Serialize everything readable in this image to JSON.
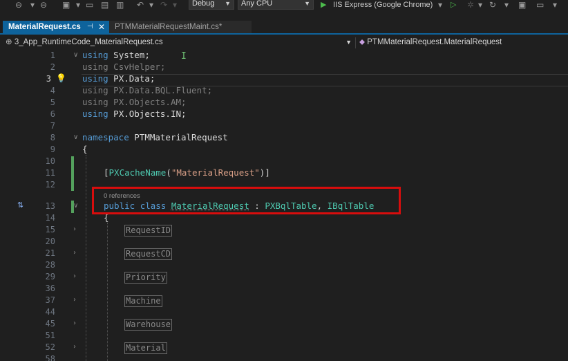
{
  "toolbar": {
    "config_select": "Debug",
    "platform_select": "Any CPU",
    "run_target": "IIS Express (Google Chrome)"
  },
  "tabs": [
    {
      "label": "MaterialRequest.cs",
      "active": true
    },
    {
      "label": "PTMMaterialRequestMaint.cs*",
      "active": false
    }
  ],
  "navbar": {
    "project": "3_App_RuntimeCode_MaterialRequest.cs",
    "member": "PTMMaterialRequest.MaterialRequest"
  },
  "editor": {
    "line_numbers": [
      "1",
      "2",
      "3",
      "4",
      "5",
      "6",
      "7",
      "8",
      "9",
      "10",
      "11",
      "12",
      "13",
      "14",
      "15",
      "20",
      "21",
      "28",
      "29",
      "36",
      "37",
      "44",
      "45",
      "51",
      "52",
      "58"
    ],
    "current_line": "3",
    "code": {
      "using": "using",
      "ns_system": "System;",
      "ns_csvhelper": "CsvHelper;",
      "ns_pxdata": "PX.Data;",
      "ns_pxdata_bql": "PX.Data.BQL.Fluent;",
      "ns_pxobjects_am": "PX.Objects.AM;",
      "ns_pxobjects_in": "PX.Objects.IN;",
      "namespace_kw": "namespace",
      "namespace_name": "PTMMaterialRequest",
      "open_brace": "{",
      "attr_open": "[",
      "attr_name": "PXCacheName",
      "attr_paren_open": "(",
      "attr_value": "\"MaterialRequest\"",
      "attr_close": ")]",
      "references": "0 references",
      "public_kw": "public",
      "class_kw": "class",
      "class_name": "MaterialRequest",
      "colon": " : ",
      "base1": "PXBqlTable",
      "comma": ", ",
      "base2": "IBqlTable",
      "class_brace": "{"
    },
    "collapsed_regions": [
      "RequestID",
      "RequestCD",
      "Priority",
      "Machine",
      "Warehouse",
      "Material"
    ]
  },
  "colors": {
    "keyword": "#569cd6",
    "type": "#4ec9b0",
    "string": "#d69d85",
    "highlight_box": "#d80d0d",
    "active_tab": "#0e639c"
  }
}
